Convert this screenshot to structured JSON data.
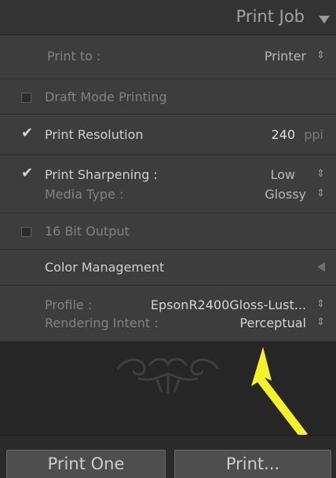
{
  "header": {
    "title": "Print Job"
  },
  "print_to": {
    "label": "Print to :",
    "value": "Printer"
  },
  "draft_mode": {
    "label": "Draft Mode Printing",
    "checked": false
  },
  "print_resolution": {
    "label": "Print Resolution",
    "value": "240",
    "unit": "ppi",
    "checked": true
  },
  "print_sharpening": {
    "label": "Print Sharpening :",
    "value": "Low",
    "checked": true,
    "media_label": "Media Type :",
    "media_value": "Glossy"
  },
  "bit_output": {
    "label": "16 Bit Output",
    "checked": false
  },
  "color_management": {
    "title": "Color Management",
    "profile_label": "Profile :",
    "profile_value": "EpsonR2400Gloss-Lust...",
    "intent_label": "Rendering Intent :",
    "intent_value": "Perceptual"
  },
  "buttons": {
    "print_one": "Print One",
    "print": "Print..."
  },
  "colors": {
    "panel": "#3d3d3d",
    "header": "#333333",
    "arrow": "#f4f22a",
    "dark": "#262626"
  }
}
